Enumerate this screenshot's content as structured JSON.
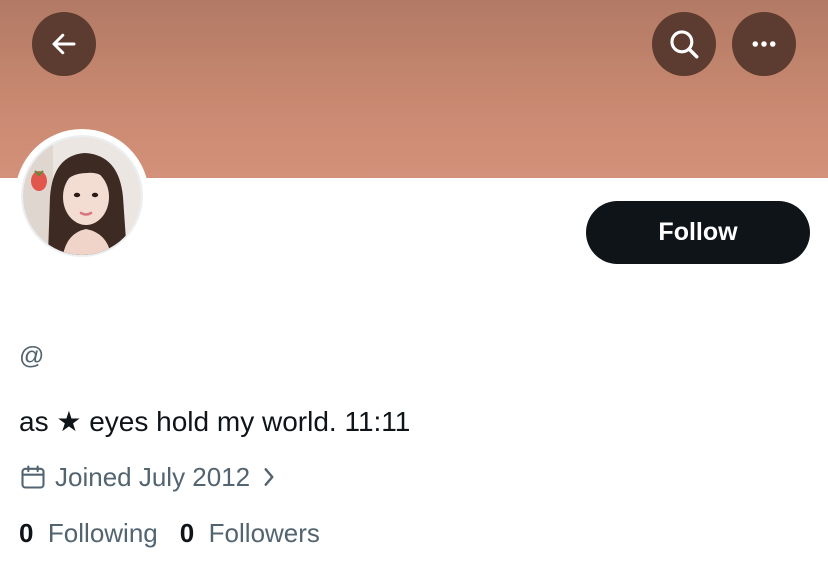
{
  "colors": {
    "banner_top": "#b27a65",
    "banner_bottom": "#d4917a",
    "header_button_bg": "#5c3b30",
    "follow_button_bg": "#0f1419",
    "secondary_text": "#536471"
  },
  "header": {
    "back_icon": "arrow-left-icon",
    "search_icon": "search-icon",
    "more_icon": "more-dots-icon"
  },
  "profile": {
    "follow_label": "Follow",
    "handle": "@",
    "bio": "as ★ eyes hold my world. 11:11",
    "joined_icon": "calendar-icon",
    "joined_text": "Joined July 2012",
    "following_count": "0",
    "following_label": "Following",
    "followers_count": "0",
    "followers_label": "Followers"
  }
}
